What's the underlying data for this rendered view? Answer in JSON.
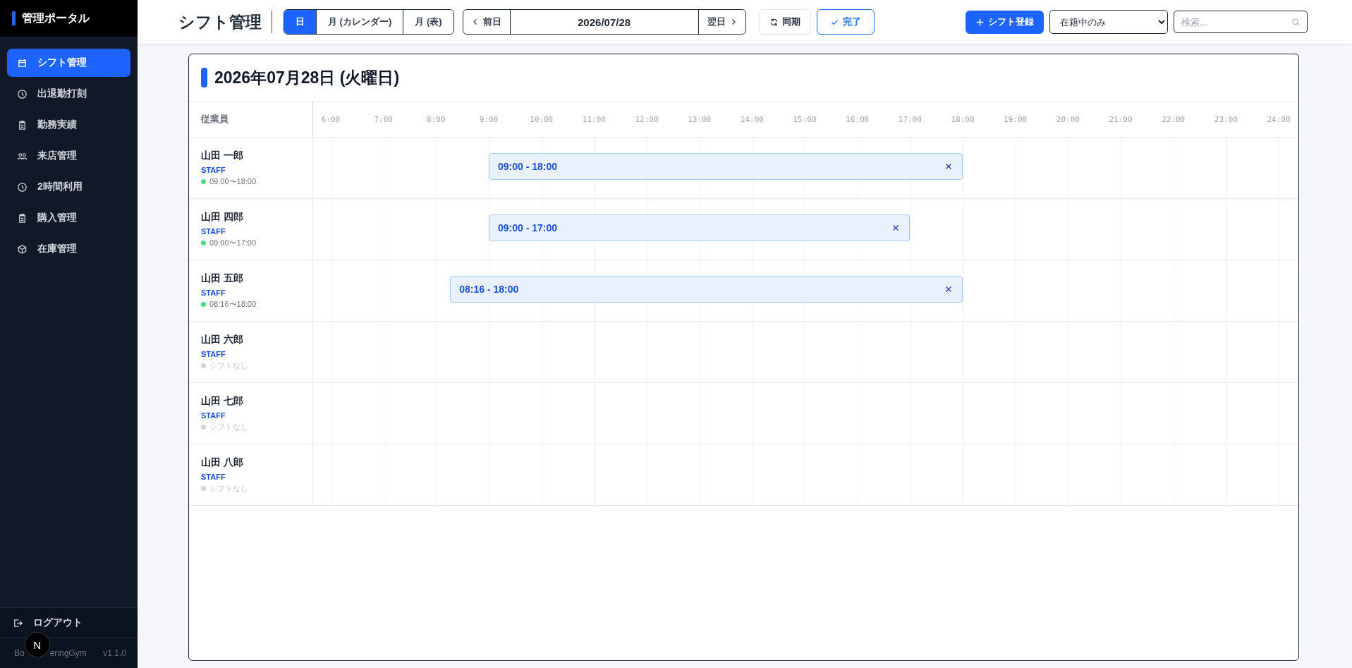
{
  "sidebar": {
    "brand": "管理ポータル",
    "items": [
      {
        "label": "シフト管理",
        "kind": "calendar",
        "selected": true
      },
      {
        "label": "出退勤打刻",
        "kind": "clock",
        "selected": false
      },
      {
        "label": "勤務実績",
        "kind": "clipboard",
        "selected": false
      },
      {
        "label": "来店管理",
        "kind": "people",
        "selected": false
      },
      {
        "label": "2時間利用",
        "kind": "clock",
        "selected": false
      },
      {
        "label": "購入管理",
        "kind": "clipboard",
        "selected": false
      },
      {
        "label": "在庫管理",
        "kind": "box",
        "selected": false
      }
    ],
    "logout": "ログアウト",
    "app_name_parts": [
      "Bo",
      "eringGym"
    ],
    "version": "v1.1.0",
    "dev_badge": "N"
  },
  "header": {
    "title": "シフト管理",
    "view_tabs": [
      {
        "label": "日",
        "selected": true
      },
      {
        "label": "月 (カレンダー)",
        "selected": false
      },
      {
        "label": "月 (表)",
        "selected": false
      }
    ],
    "prev": "前日",
    "date": "2026/07/28",
    "next": "翌日",
    "sync": "同期",
    "done": "完了",
    "add": "シフト登録",
    "filter": {
      "value": "在籍中のみ"
    },
    "search": {
      "placeholder": "検索..."
    }
  },
  "schedule": {
    "title": "2026年07月28日 (火曜日)",
    "employee_column": "従業員",
    "hours": [
      "6:00",
      "7:00",
      "8:00",
      "9:00",
      "10:00",
      "11:00",
      "12:00",
      "13:00",
      "14:00",
      "15:00",
      "16:00",
      "17:00",
      "18:00",
      "19:00",
      "20:00",
      "21:00",
      "22:00",
      "23:00",
      "24:00"
    ],
    "employees": [
      {
        "name": "山田 一郎",
        "role": "STAFF",
        "color": "#4ade80",
        "hours": "09:00〜18:00",
        "shift": "09:00 - 18:00"
      },
      {
        "name": "山田 四郎",
        "role": "STAFF",
        "color": "#4ade80",
        "hours": "09:00〜17:00",
        "shift": "09:00 - 17:00"
      },
      {
        "name": "山田 五郎",
        "role": "STAFF",
        "color": "#4ade80",
        "hours": "08:16〜18:00",
        "shift": "08:16 - 18:00"
      },
      {
        "name": "山田 六郎",
        "role": "STAFF",
        "color": "#d1d5db",
        "hours": "シフトなし"
      },
      {
        "name": "山田 七郎",
        "role": "STAFF",
        "color": "#d1d5db",
        "hours": "シフトなし"
      },
      {
        "name": "山田 八郎",
        "role": "STAFF",
        "color": "#d1d5db",
        "hours": "シフトなし"
      }
    ]
  }
}
